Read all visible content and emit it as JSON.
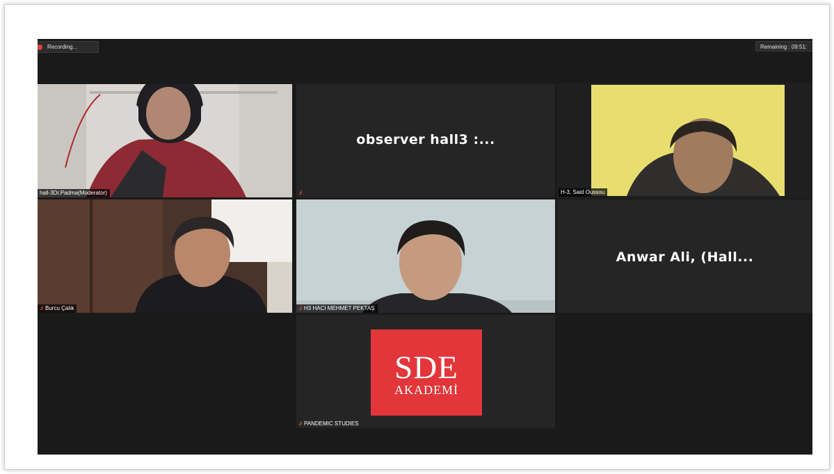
{
  "topbar": {
    "recording_label": "Recording...",
    "remaining_label": "Remaining : 09:51:"
  },
  "participants": [
    {
      "label": "hall-3Dr.Padma(Moderator)",
      "video": true,
      "muted": false
    },
    {
      "label": "",
      "video": false,
      "display_name": "observer hall3 :...",
      "muted": true
    },
    {
      "label": "H-3, Said Oussou",
      "video": true,
      "muted": false,
      "active_speaker": true
    },
    {
      "label": "Burcu Çalık",
      "video": true,
      "muted": true
    },
    {
      "label": "H3 HACI MEHMET PEKTAŞ",
      "video": true,
      "muted": true
    },
    {
      "label": "",
      "video": false,
      "display_name": "Anwar Ali, (Hall...",
      "muted": false
    },
    {
      "label": "PANDEMIC STUDIES",
      "video": true,
      "muted": true,
      "logo": {
        "title": "SDE",
        "subtitle": "AKADEMİ"
      }
    }
  ],
  "colors": {
    "active_speaker_border": "#d9e96a",
    "muted_icon": "#ff4a3a",
    "recording_dot": "#e2403a",
    "logo_background": "#e2363a"
  },
  "icons": {
    "mute": "mic-muted-icon",
    "recording": "recording-dot-icon"
  }
}
